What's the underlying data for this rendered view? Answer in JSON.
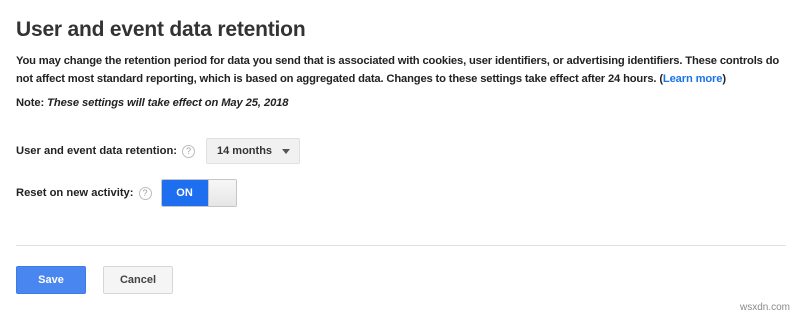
{
  "section": {
    "title": "User and event data retention",
    "description": "You may change the retention period for data you send that is associated with cookies, user identifiers, or advertising identifiers. These controls do not affect most standard reporting, which is based on aggregated data. Changes to these settings take effect after 24 hours.",
    "learn_more_open": "(",
    "learn_more_label": "Learn more",
    "learn_more_close": ")",
    "note_label": "Note:",
    "note_text": "These settings will take effect on May 25, 2018"
  },
  "retention": {
    "label": "User and event data retention:",
    "help_icon": "?",
    "selected": "14 months"
  },
  "reset": {
    "label": "Reset on new activity:",
    "help_icon": "?",
    "toggle_label": "ON",
    "toggle_state": "on"
  },
  "actions": {
    "save_label": "Save",
    "cancel_label": "Cancel"
  },
  "watermark": "wsxdn.com",
  "colors": {
    "accent": "#4a86f0",
    "toggle_on": "#1e6ff0",
    "link": "#1a73e8"
  }
}
